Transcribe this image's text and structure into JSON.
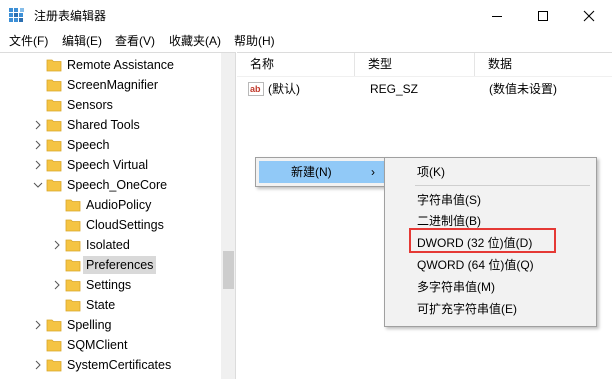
{
  "window": {
    "title": "注册表编辑器"
  },
  "menubar": {
    "items": [
      "文件(F)",
      "编辑(E)",
      "查看(V)",
      "收藏夹(A)",
      "帮助(H)"
    ]
  },
  "tree": {
    "items": [
      {
        "label": "Remote Assistance",
        "expander": "none"
      },
      {
        "label": "ScreenMagnifier",
        "expander": "none"
      },
      {
        "label": "Sensors",
        "expander": "none"
      },
      {
        "label": "Shared Tools",
        "expander": "collapsed"
      },
      {
        "label": "Speech",
        "expander": "collapsed"
      },
      {
        "label": "Speech Virtual",
        "expander": "collapsed"
      },
      {
        "label": "Speech_OneCore",
        "expander": "expanded"
      },
      {
        "label": "AudioPolicy",
        "expander": "none"
      },
      {
        "label": "CloudSettings",
        "expander": "none"
      },
      {
        "label": "Isolated",
        "expander": "collapsed"
      },
      {
        "label": "Preferences",
        "expander": "none",
        "selected": true
      },
      {
        "label": "Settings",
        "expander": "collapsed"
      },
      {
        "label": "State",
        "expander": "none"
      },
      {
        "label": "Spelling",
        "expander": "collapsed"
      },
      {
        "label": "SQMClient",
        "expander": "none"
      },
      {
        "label": "SystemCertificates",
        "expander": "collapsed"
      }
    ]
  },
  "list": {
    "columns": [
      "名称",
      "类型",
      "数据"
    ],
    "rows": [
      {
        "name": "(默认)",
        "type": "REG_SZ",
        "data": "(数值未设置)",
        "icon": "string-value-icon"
      }
    ]
  },
  "context_menu": {
    "new_label": "新建(N)",
    "arrow": "›"
  },
  "submenu": {
    "items": [
      {
        "label": "项(K)"
      },
      {
        "label": "字符串值(S)"
      },
      {
        "label": "二进制值(B)"
      },
      {
        "label": "DWORD (32 位)值(D)",
        "highlighted": true
      },
      {
        "label": "QWORD (64 位)值(Q)"
      },
      {
        "label": "多字符串值(M)"
      },
      {
        "label": "可扩充字符串值(E)"
      }
    ]
  },
  "colors": {
    "folder": "#f5c443",
    "selection": "#91c9f7",
    "highlight_border": "#e53935"
  }
}
